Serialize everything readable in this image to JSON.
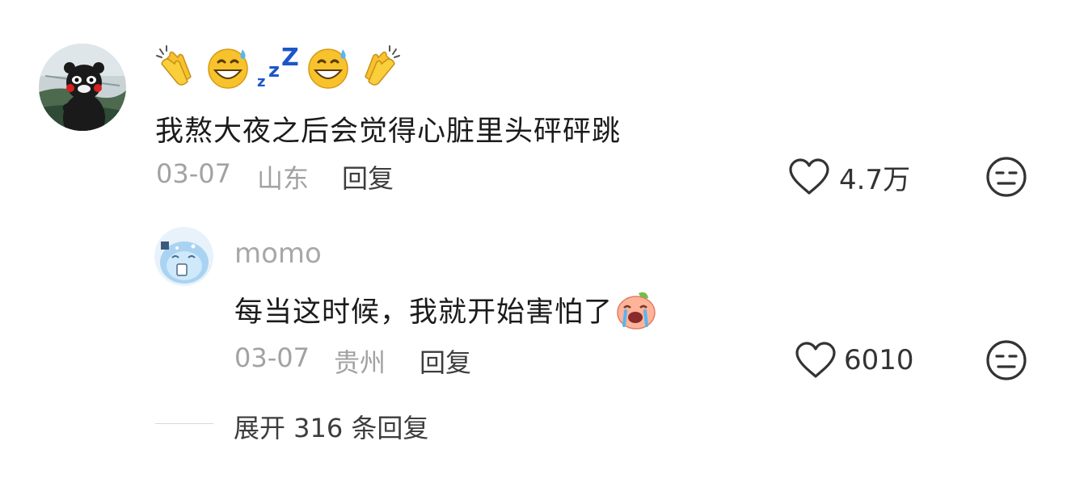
{
  "comment": {
    "emoji_names": [
      "clapping-hands",
      "grinning-sweat",
      "zzz",
      "grinning-sweat",
      "clapping-hands"
    ],
    "text": "我熬大夜之后会觉得心脏里头砰砰跳",
    "date": "03-07",
    "location": "山东",
    "reply_label": "回复",
    "like_count": "4.7万",
    "reply": {
      "username": "momo",
      "text": "每当这时候，我就开始害怕了",
      "date": "03-07",
      "location": "贵州",
      "reply_label": "回复",
      "like_count": "6010"
    },
    "expand_label": "展开 316 条回复"
  },
  "colors": {
    "meta_gray": "#a2a2a2",
    "text_dark": "#1b1b1b",
    "emoji_yellow": "#f7c22c",
    "zzz_blue": "#1d56c9"
  }
}
